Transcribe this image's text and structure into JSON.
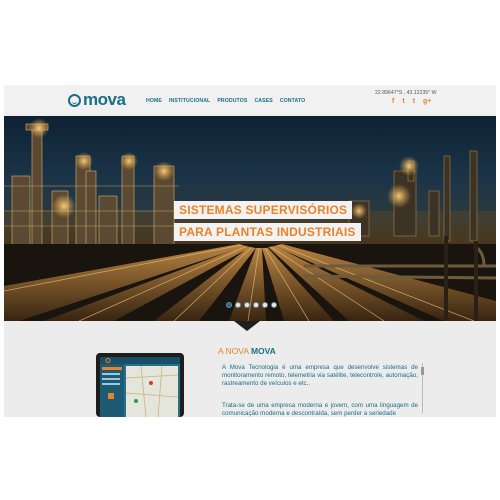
{
  "header": {
    "logo_text": "mova",
    "nav": [
      "HOME",
      "INSTITUCIONAL",
      "PRODUTOS",
      "CASES",
      "CONTATO"
    ],
    "coords": "22.89647°S , 43.12235° W",
    "social": [
      {
        "icon": "facebook-icon",
        "glyph": "f"
      },
      {
        "icon": "twitter-icon",
        "glyph": "t"
      },
      {
        "icon": "tumblr-icon",
        "glyph": "t"
      },
      {
        "icon": "google-plus-icon",
        "glyph": "g+"
      }
    ]
  },
  "hero": {
    "title_line1": "SISTEMAS SUPERVISÓRIOS",
    "title_line2": "PARA PLANTAS INDUSTRIAIS",
    "slides": 6,
    "active_slide": 1
  },
  "about": {
    "title_prefix": "A NOVA",
    "title_brand": "MOVA",
    "paragraph1": "A Mova Tecnologia é uma empresa que desenvolve sistemas de monitoramento remoto, telemetria via satélite, telecontrole, automação, rastreamento de veículos e etc..",
    "paragraph2": "Trata-se de uma empresa moderna e jovem, com uma linguagem de comunicação moderna e descontraída, sem perder a seriedade"
  },
  "colors": {
    "brand": "#1a6e86",
    "accent": "#e8832a"
  }
}
